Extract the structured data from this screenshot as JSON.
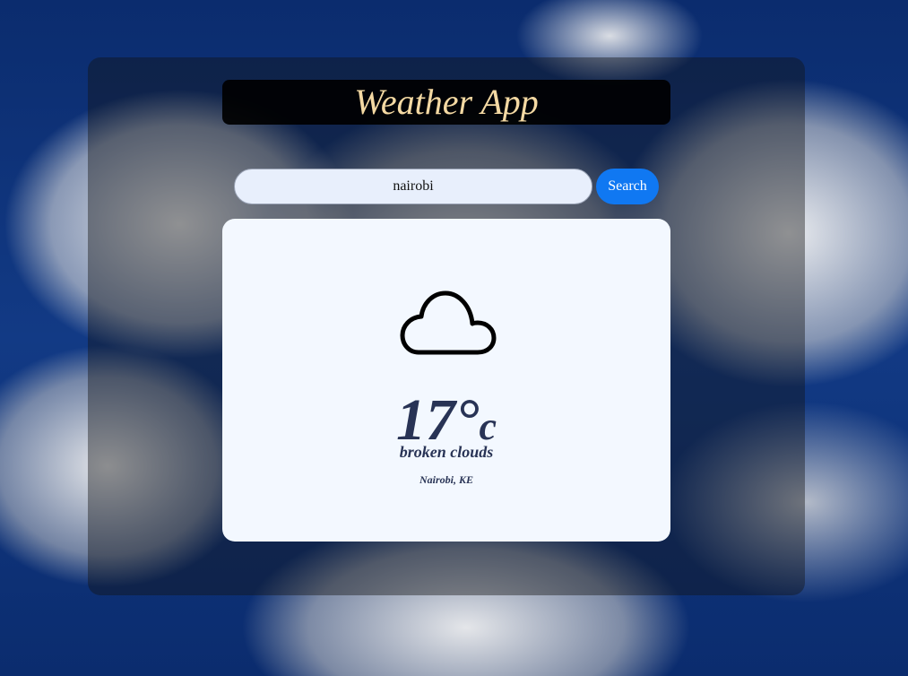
{
  "app": {
    "title": "Weather App"
  },
  "search": {
    "value": "nairobi",
    "button_label": "Search"
  },
  "weather": {
    "icon": "cloud-icon",
    "temperature": "17°",
    "unit": "c",
    "description": "broken clouds",
    "location": "Nairobi, KE"
  },
  "colors": {
    "title_text": "#f4d9a3",
    "search_button": "#1078f2",
    "card_background": "#f3f8ff",
    "card_text": "#283355"
  }
}
